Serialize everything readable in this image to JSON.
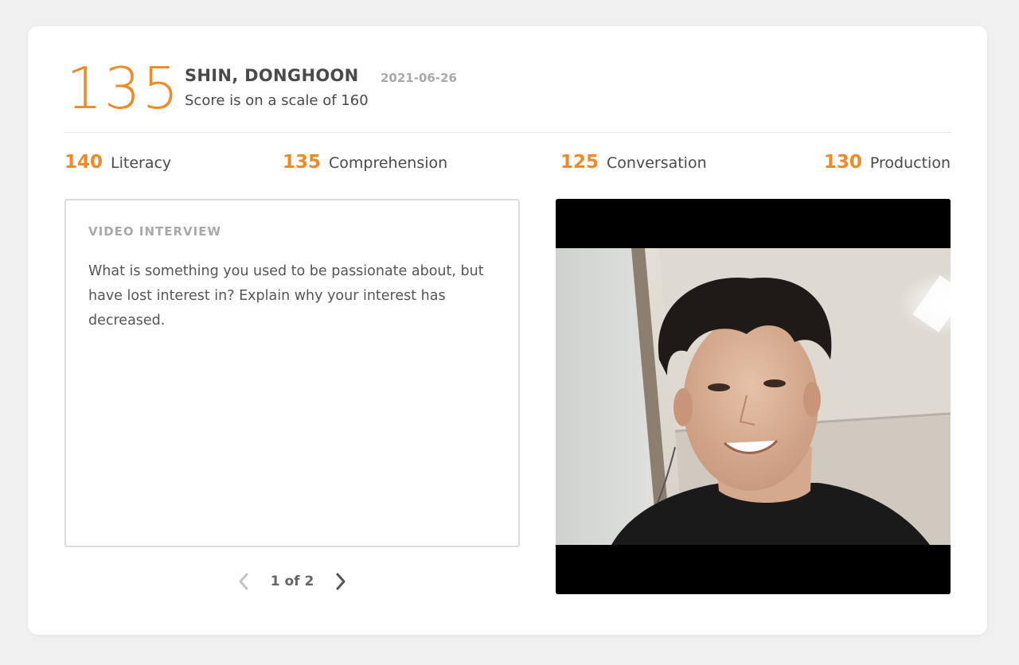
{
  "header": {
    "overall_score": "135",
    "candidate_name": "SHIN, DONGHOON",
    "date": "2021-06-26",
    "scale_note": "Score is on a scale of 160"
  },
  "subscores": [
    {
      "value": "140",
      "label": "Literacy"
    },
    {
      "value": "135",
      "label": "Comprehension"
    },
    {
      "value": "125",
      "label": "Conversation"
    },
    {
      "value": "130",
      "label": "Production"
    }
  ],
  "interview": {
    "heading": "VIDEO INTERVIEW",
    "question": "What is something you used to be passionate about, but have lost interest in? Explain why your interest has decreased."
  },
  "pager": {
    "text": "1 of 2",
    "prev_icon": "chevron-left-icon",
    "next_icon": "chevron-right-icon"
  },
  "video": {
    "content": "video-frame"
  },
  "colors": {
    "accent": "#f08a24",
    "text": "#4a4a4a",
    "muted": "#a9a9a9",
    "background": "#f0f0f0"
  }
}
